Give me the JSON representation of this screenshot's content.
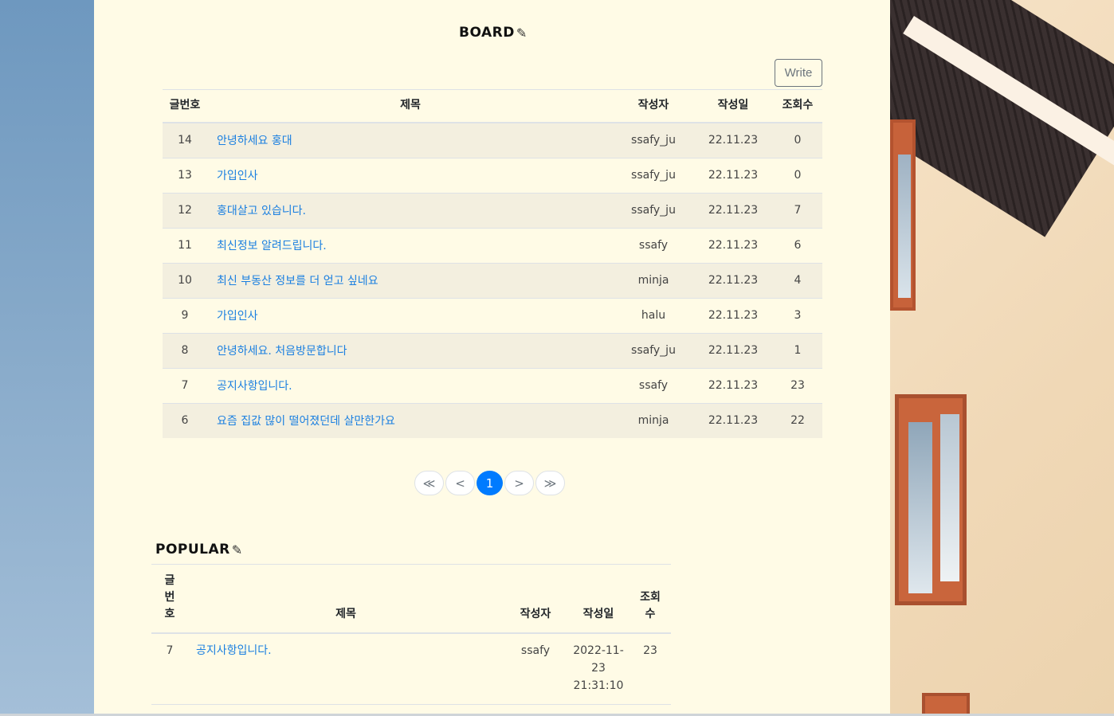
{
  "board": {
    "title": "BOARD",
    "write_label": "Write",
    "headers": {
      "no": "글번호",
      "title": "제목",
      "writer": "작성자",
      "date": "작성일",
      "views": "조회수"
    },
    "rows": [
      {
        "no": "14",
        "title": "안녕하세요 홍대",
        "writer": "ssafy_ju",
        "date": "22.11.23",
        "views": "0"
      },
      {
        "no": "13",
        "title": "가입인사",
        "writer": "ssafy_ju",
        "date": "22.11.23",
        "views": "0"
      },
      {
        "no": "12",
        "title": "홍대살고 있습니다.",
        "writer": "ssafy_ju",
        "date": "22.11.23",
        "views": "7"
      },
      {
        "no": "11",
        "title": "최신정보 알려드립니다.",
        "writer": "ssafy",
        "date": "22.11.23",
        "views": "6"
      },
      {
        "no": "10",
        "title": "최신 부동산 정보를 더 얻고 싶네요",
        "writer": "minja",
        "date": "22.11.23",
        "views": "4"
      },
      {
        "no": "9",
        "title": "가입인사",
        "writer": "halu",
        "date": "22.11.23",
        "views": "3"
      },
      {
        "no": "8",
        "title": "안녕하세요. 처음방문합니다",
        "writer": "ssafy_ju",
        "date": "22.11.23",
        "views": "1"
      },
      {
        "no": "7",
        "title": "공지사항입니다.",
        "writer": "ssafy",
        "date": "22.11.23",
        "views": "23"
      },
      {
        "no": "6",
        "title": "요즘 집값 많이 떨어졌던데 살만한가요",
        "writer": "minja",
        "date": "22.11.23",
        "views": "22"
      }
    ]
  },
  "pagination": {
    "first": "≪",
    "prev": "<",
    "current": "1",
    "next": ">",
    "last": "≫"
  },
  "popular": {
    "title": "POPULAR",
    "headers": {
      "no": "글번호",
      "title": "제목",
      "writer": "작성자",
      "date": "작성일",
      "views": "조회수"
    },
    "rows": [
      {
        "no": "7",
        "title": "공지사항입니다.",
        "writer": "ssafy",
        "date": "2022-11-23 21:31:10",
        "views": "23"
      }
    ]
  },
  "icons": {
    "title_icon": "pencil-icon"
  },
  "colors": {
    "panel_bg": "#fffbe6",
    "link": "#1a7fe0",
    "active_page": "#007bff",
    "striped_row": "#f3efdf"
  }
}
